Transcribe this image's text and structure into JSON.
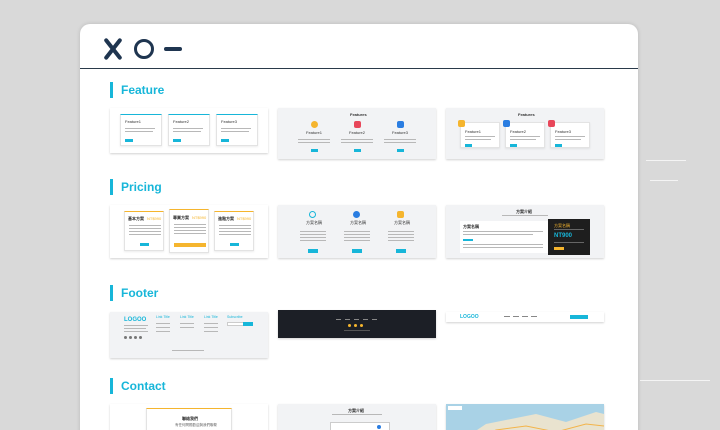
{
  "sections": [
    {
      "title": "Feature"
    },
    {
      "title": "Pricing"
    },
    {
      "title": "Footer"
    },
    {
      "title": "Contact"
    }
  ],
  "feature": {
    "t1": {
      "cards": [
        "Feature1",
        "Feature2",
        "Feature3"
      ]
    },
    "t2": {
      "title": "Features",
      "cards": [
        "Feature1",
        "Feature2",
        "Feature3"
      ]
    },
    "t3": {
      "title": "Features",
      "cards": [
        "Feature1",
        "Feature2",
        "Feature3"
      ]
    }
  },
  "pricing": {
    "t1": {
      "plans": [
        "基本方案",
        "專業方案",
        "進階方案"
      ],
      "price": "NT$990"
    },
    "t2": {
      "plans": [
        "方案名稱",
        "方案名稱",
        "方案名稱"
      ]
    },
    "t3": {
      "title": "方案介紹",
      "left": "方案名稱",
      "price": "NT900",
      "dark_label": "方案名稱"
    }
  },
  "footer": {
    "t1": {
      "logo": "LOGOO",
      "cols": [
        "Link Title",
        "Link Title",
        "Link Title"
      ],
      "subscribe": "Subscribe"
    },
    "t3": {
      "logo": "LOGOO"
    }
  },
  "contact": {
    "t1": {
      "title": "聯絡我們",
      "subtitle": "有任何問題歡迎與我們聯繫"
    },
    "t2": {
      "title": "方案介紹"
    }
  }
}
